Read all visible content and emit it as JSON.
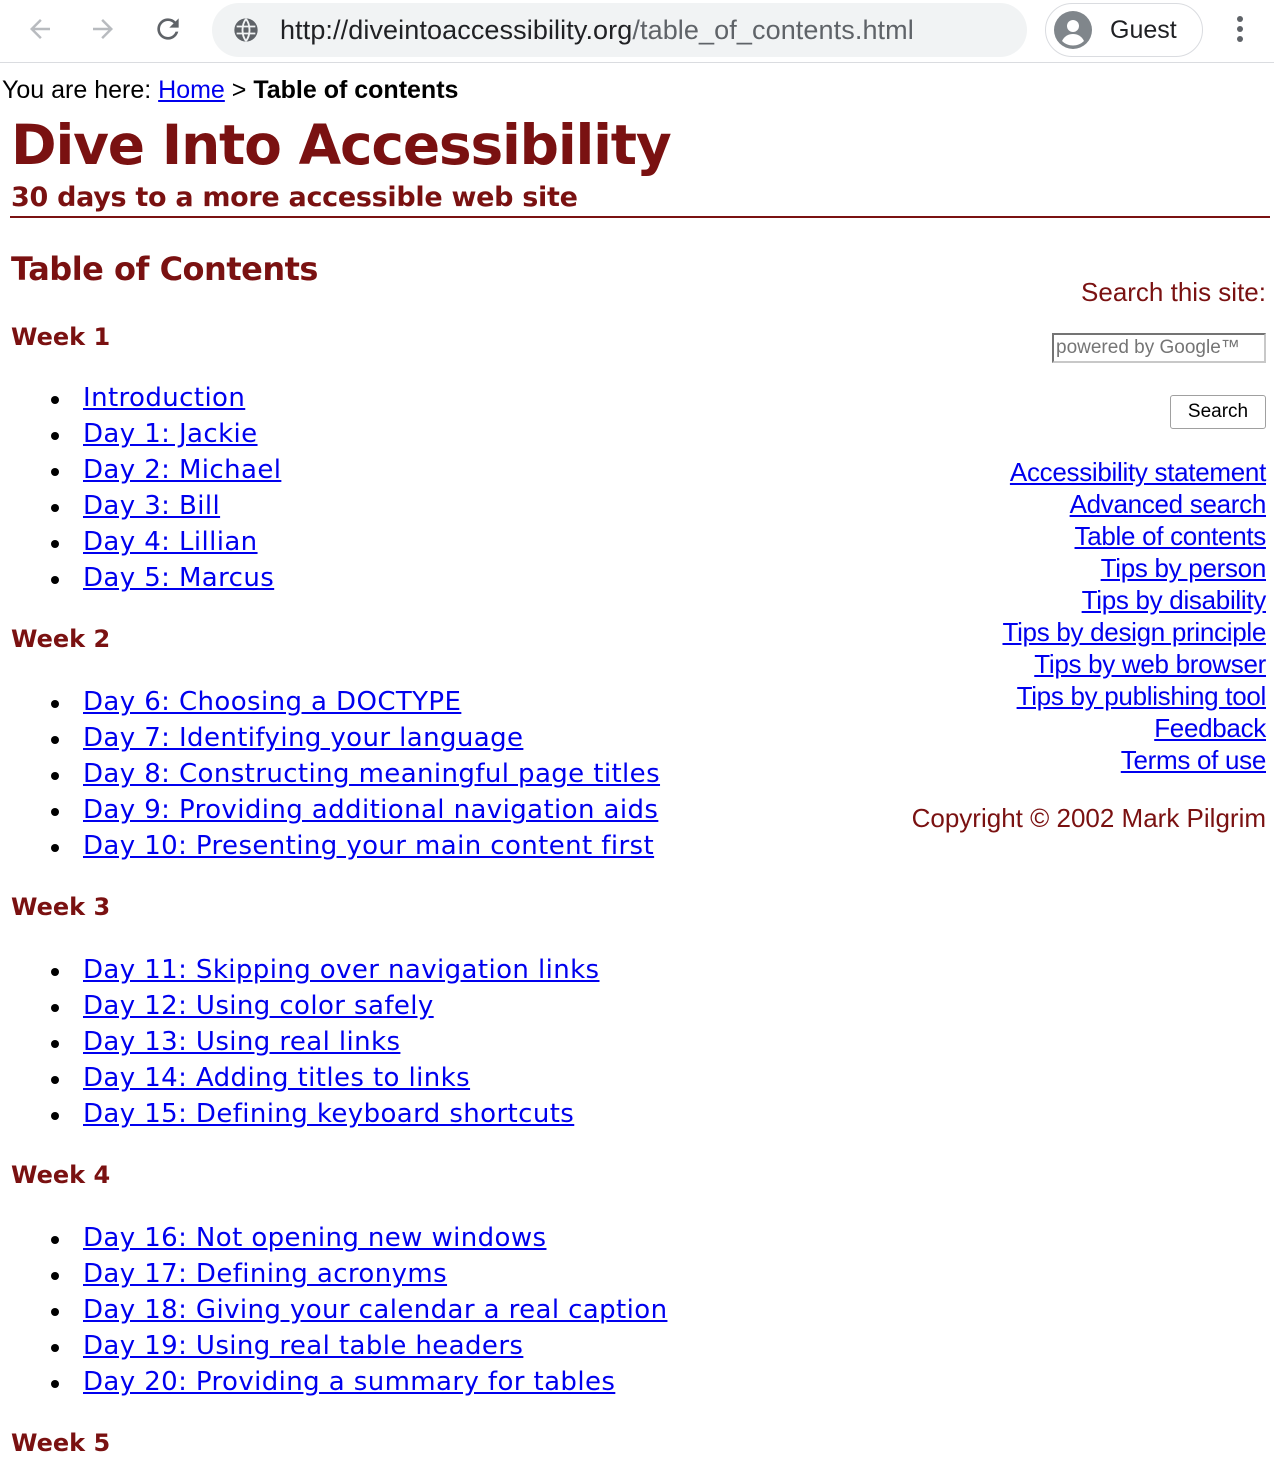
{
  "browser": {
    "url_host": "http://diveintoaccessibility.org",
    "url_path": "/table_of_contents.html",
    "profile_name": "Guest"
  },
  "breadcrumb": {
    "prefix": "You are here: ",
    "home_label": "Home",
    "separator": " > ",
    "current": "Table of contents"
  },
  "header": {
    "title": "Dive Into Accessibility",
    "tagline": "30 days to a more accessible web site"
  },
  "main": {
    "heading": "Table of Contents",
    "weeks": [
      {
        "label": "Week 1",
        "items": [
          "Introduction",
          "Day 1: Jackie",
          "Day 2: Michael",
          "Day 3: Bill",
          "Day 4: Lillian",
          "Day 5: Marcus"
        ]
      },
      {
        "label": "Week 2",
        "items": [
          "Day 6: Choosing a DOCTYPE",
          "Day 7: Identifying your language",
          "Day 8: Constructing meaningful page titles",
          "Day 9: Providing additional navigation aids",
          "Day 10: Presenting your main content first"
        ]
      },
      {
        "label": "Week 3",
        "items": [
          "Day 11: Skipping over navigation links",
          "Day 12: Using color safely",
          "Day 13: Using real links",
          "Day 14: Adding titles to links",
          "Day 15: Defining keyboard shortcuts"
        ]
      },
      {
        "label": "Week 4",
        "items": [
          "Day 16: Not opening new windows",
          "Day 17: Defining acronyms",
          "Day 18: Giving your calendar a real caption",
          "Day 19: Using real table headers",
          "Day 20: Providing a summary for tables"
        ]
      },
      {
        "label": "Week 5",
        "items": []
      }
    ]
  },
  "sidebar": {
    "search_label": "Search this site:",
    "search_placeholder": "powered by Google™",
    "search_button": "Search",
    "links": [
      "Accessibility statement",
      "Advanced search",
      "Table of contents",
      "Tips by person",
      "Tips by disability",
      "Tips by design principle",
      "Tips by web browser",
      "Tips by publishing tool",
      "Feedback",
      "Terms of use"
    ],
    "copyright": "Copyright © 2002 Mark Pilgrim"
  },
  "colors": {
    "brand": "#7a1111",
    "link": "#0000ee",
    "omnibox_bg": "#f1f3f4"
  },
  "icons": {
    "back": "arrow-left-icon",
    "forward": "arrow-right-icon",
    "reload": "reload-icon",
    "site_info": "globe-icon",
    "avatar": "person-icon",
    "menu": "kebab-menu-icon"
  }
}
